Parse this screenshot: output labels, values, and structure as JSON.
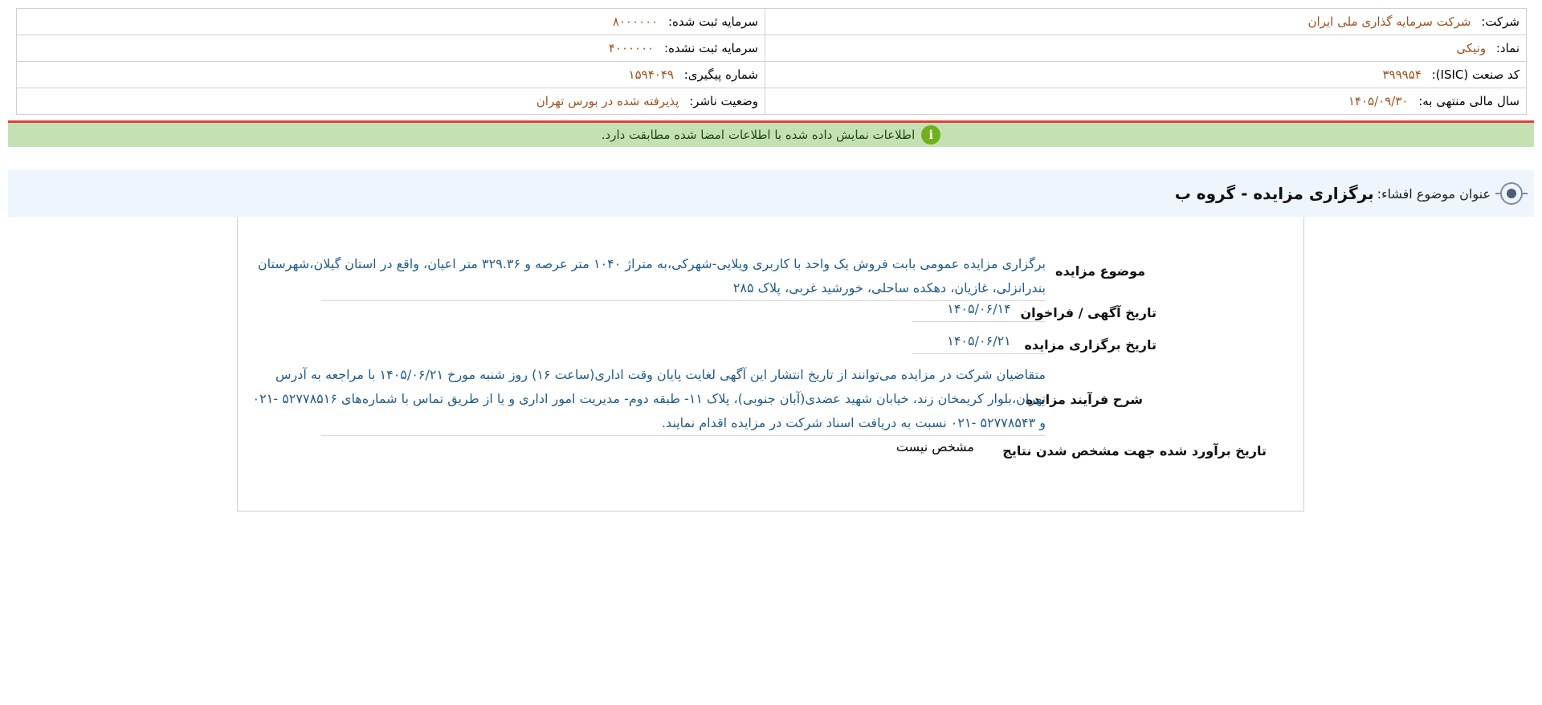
{
  "company_info": {
    "company_label": "شرکت:",
    "company_value": "شرکت سرمایه گذاری ملی ایران",
    "symbol_label": "نماد:",
    "symbol_value": "ونیکی",
    "isic_label": "کد صنعت (ISIC):",
    "isic_value": "۳۹۹۹۵۴",
    "fiscal_label": "سال مالی منتهی به:",
    "fiscal_value": "۱۴۰۵/۰۹/۳۰",
    "reg_capital_label": "سرمایه ثبت شده:",
    "reg_capital_value": "۸۰۰۰۰۰۰",
    "unreg_capital_label": "سرمایه ثبت نشده:",
    "unreg_capital_value": "۴۰۰۰۰۰۰",
    "tracking_label": "شماره پیگیری:",
    "tracking_value": "۱۵۹۴۰۴۹",
    "publisher_status_label": "وضعیت ناشر:",
    "publisher_status_value": "پذیرفته شده در بورس تهران"
  },
  "verification": {
    "icon": "info-icon",
    "message": "اطلاعات نمایش داده شده با اطلاعات امضا شده مطابقت دارد."
  },
  "disclosure": {
    "title_label": "عنوان موضوع افشاء:",
    "title_value": "برگزاری مزایده - گروه ب"
  },
  "auction": {
    "subject_label": "موضوع مزایده",
    "subject_line1": "برگزاری مزایده عمومی بابت فروش یک واحد با کاربری ویلایی-شهرکی،به متراژ ۱۰۴۰ متر عرصه و ۳۲۹.۳۶ متر اعیان، واقع در استان گیلان،شهرستان",
    "subject_line2": "بندرانزلی، غازیان، دهکده ساحلی، خورشید غربی، پلاک ۲۸۵",
    "announce_label": "تاریخ آگهی / فراخوان",
    "announce_value": "۱۴۰۵/۰۶/۱۴",
    "held_label": "تاریخ برگزاری مزایده",
    "held_value": "۱۴۰۵/۰۶/۲۱",
    "process_label": "شرح فرآیند مزایده",
    "process_line1": "متقاضیان شرکت در مزایده می‌توانند از تاریخ انتشار این آگهی لغایت پایان وقت اداری(ساعت ۱۶) روز شنبه مورخ ۱۴۰۵/۰۶/۲۱ با مراجعه به آدرس",
    "process_line2": "تهران،بلوار کریمخان زند، خیابان شهید عضدی(آبان جنوبی)، پلاک ۱۱- طبقه دوم- مدیریت امور اداری و یا از طریق تماس با شماره‌های ۵۲۷۷۸۵۱۶ -۰۲۱",
    "process_line3": "و ۵۲۷۷۸۵۴۳ -۰۲۱ نسبت به دریافت اسناد شرکت در مزایده اقدام نمایند.",
    "estimate_label": "تاریخ برآورد شده جهت مشخص شدن نتایج",
    "estimate_value": "مشخص نیست"
  }
}
